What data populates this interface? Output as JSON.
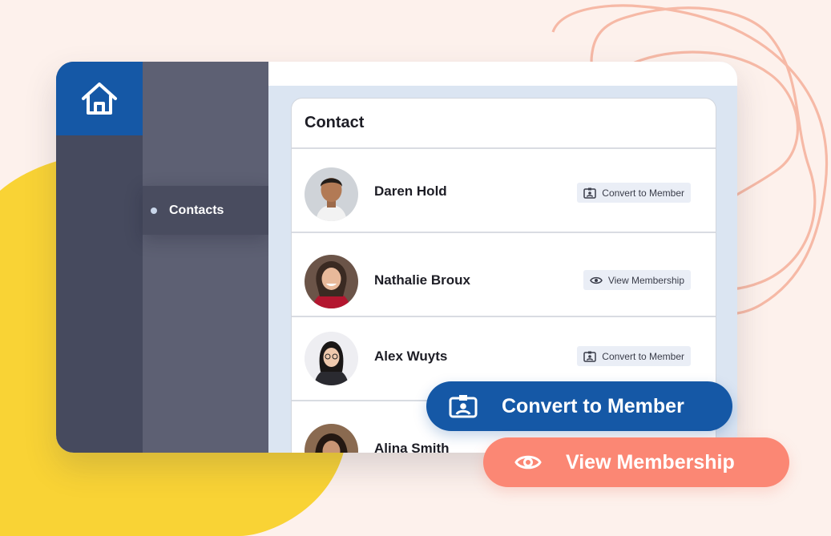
{
  "colors": {
    "page_background": "#fdf1ec",
    "yellow_blob": "#f9d335",
    "peach_line": "#f6b9a6",
    "rail": "#464a5e",
    "home_tile": "#1558a6",
    "nav_panel": "#5d6073",
    "content_background": "#dbe5f2",
    "primary_button": "#1558a6",
    "secondary_button": "#fb8774"
  },
  "sidebar": {
    "home_icon": "home-icon",
    "items": [
      {
        "label": "Contacts",
        "active": true
      }
    ]
  },
  "card": {
    "title": "Contact",
    "contacts": [
      {
        "name": "Daren Hold",
        "action_label": "Convert to Member",
        "action_icon": "id-badge-icon"
      },
      {
        "name": "Nathalie Broux",
        "action_label": "View Membership",
        "action_icon": "eye-icon"
      },
      {
        "name": "Alex Wuyts",
        "action_label": "Convert to Member",
        "action_icon": "id-badge-icon"
      },
      {
        "name": "Alina Smith"
      }
    ]
  },
  "floating_buttons": {
    "convert": {
      "label": "Convert to Member",
      "icon": "id-badge-icon"
    },
    "view": {
      "label": "View Membership",
      "icon": "eye-icon"
    }
  }
}
